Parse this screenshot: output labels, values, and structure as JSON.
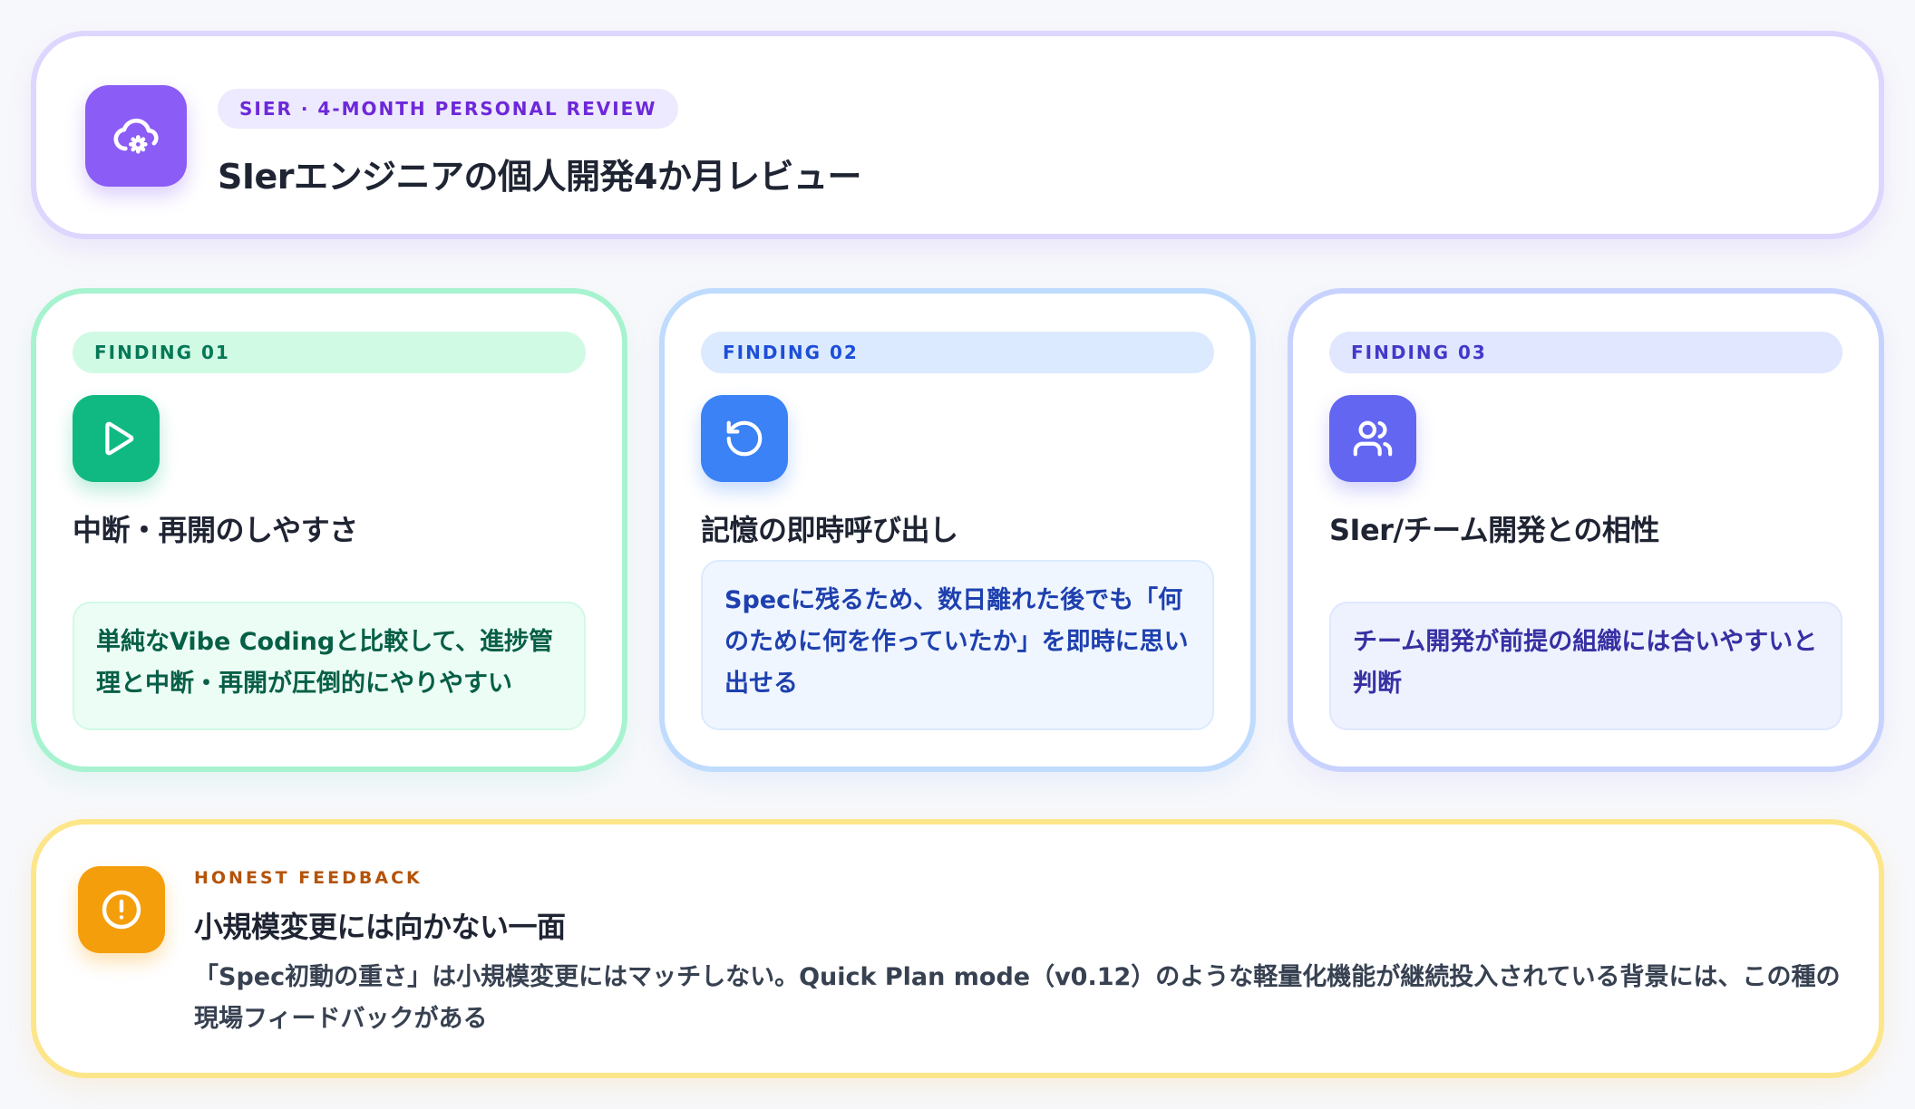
{
  "header": {
    "icon": "cloud-gear-icon",
    "badge": "SIER · 4-MONTH PERSONAL REVIEW",
    "title": "SIerエンジニアの個人開発4か月レビュー",
    "accent_color": "#8b5cf6"
  },
  "findings": [
    {
      "badge": "FINDING 01",
      "icon": "play-icon",
      "title": "中断・再開のしやすさ",
      "body": "単純なVibe Codingと比較して、進捗管理と中断・再開が圧倒的にやりやすい",
      "accent_color": "#10b981"
    },
    {
      "badge": "FINDING 02",
      "icon": "rotate-ccw-icon",
      "title": "記憶の即時呼び出し",
      "body": "Specに残るため、数日離れた後でも「何のために何を作っていたか」を即時に思い出せる",
      "accent_color": "#3b82f6"
    },
    {
      "badge": "FINDING 03",
      "icon": "users-icon",
      "title": "SIer/チーム開発との相性",
      "body": "チーム開発が前提の組織には合いやすいと判断",
      "accent_color": "#6366f1"
    }
  ],
  "feedback": {
    "icon": "alert-circle-icon",
    "label": "HONEST FEEDBACK",
    "title": "小規模変更には向かない一面",
    "body": "「Spec初動の重さ」は小規模変更にはマッチしない。Quick Plan mode（v0.12）のような軽量化機能が継続投入されている背景には、この種の現場フィードバックがある",
    "accent_color": "#f59e0b"
  }
}
